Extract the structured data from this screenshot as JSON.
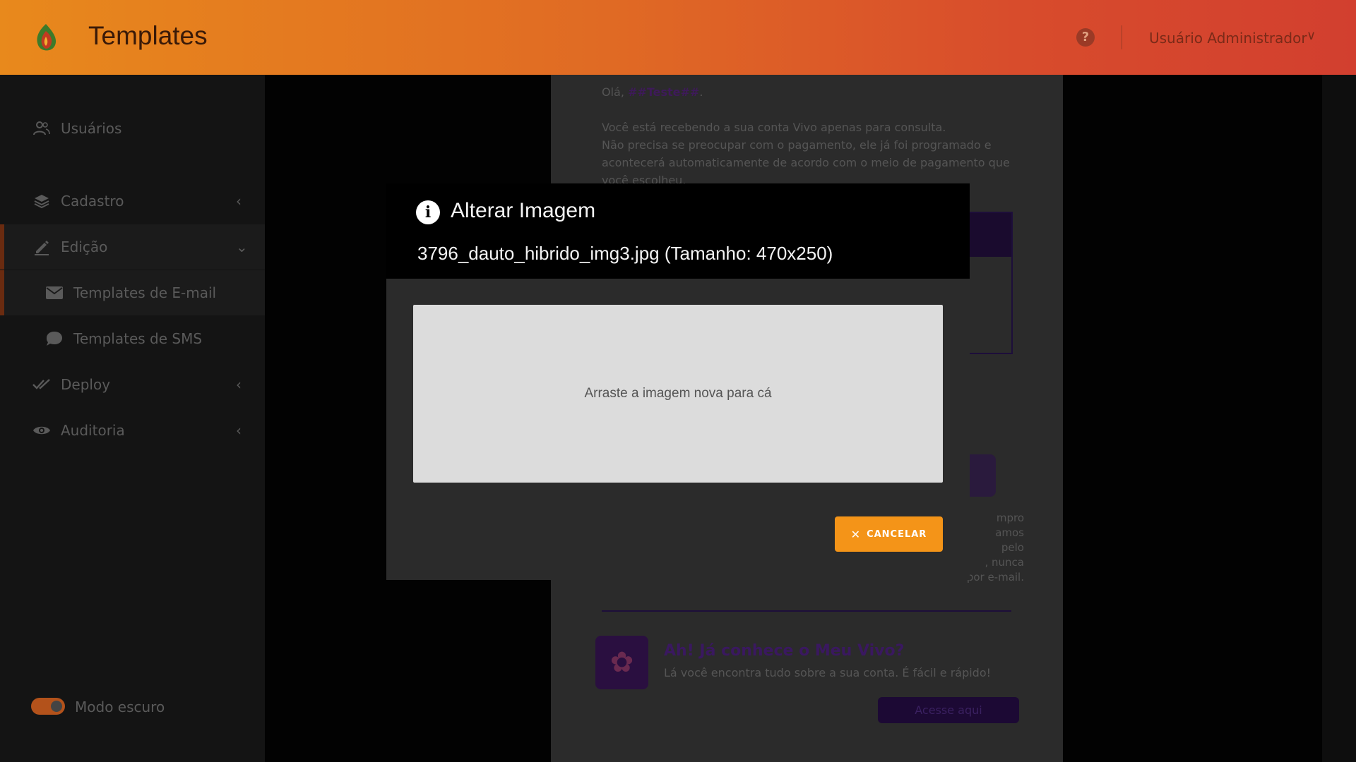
{
  "header": {
    "title": "Templates",
    "help_icon": "?",
    "user_name": "Usuário Administrador",
    "user_chevron": "∨"
  },
  "sidebar": {
    "items": [
      {
        "label": "Usuários",
        "icon": "users-icon"
      },
      {
        "label": "Cadastro",
        "icon": "layers-icon",
        "chevron": "‹"
      },
      {
        "label": "Edição",
        "icon": "edit-icon",
        "chevron": "⌄"
      },
      {
        "label": "Templates de E-mail",
        "icon": "mail-icon"
      },
      {
        "label": "Templates de SMS",
        "icon": "chat-icon"
      },
      {
        "label": "Deploy",
        "icon": "double-check-icon",
        "chevron": "‹"
      },
      {
        "label": "Auditoria",
        "icon": "eye-icon",
        "chevron": "‹"
      }
    ],
    "dark_mode_label": "Modo escuro"
  },
  "email_preview": {
    "greeting_prefix": "Olá, ",
    "greeting_var": "##Teste##",
    "greeting_suffix": ".",
    "line1": "Você está recebendo a sua conta Vivo apenas para consulta.",
    "line2": "Não precisa se preocupar com o pagamento, ele já foi programado e acontecerá automaticamente de acordo com o meio de pagamento que você escolheu.",
    "fragment1": "mpro",
    "fragment2": "amos",
    "fragment3": "pelo",
    "fragment4": ", nunca",
    "fragment5": "por e-mail.",
    "promo_title": "Ah! Já conhece o Meu Vivo?",
    "promo_sub": "Lá você encontra tudo sobre a sua conta. É fácil e rápido!",
    "cta": "Acesse aqui"
  },
  "modal": {
    "title": "Alterar Imagem",
    "info_icon": "i",
    "file_info": "3796_dauto_hibrido_img3.jpg (Tamanho: 470x250)",
    "dropzone_text": "Arraste a imagem nova para cá",
    "cancel_label": "CANCELAR",
    "cancel_icon": "✕"
  },
  "colors": {
    "accent": "#f49418",
    "header_start": "#e8891c",
    "header_end": "#d23f2f"
  }
}
